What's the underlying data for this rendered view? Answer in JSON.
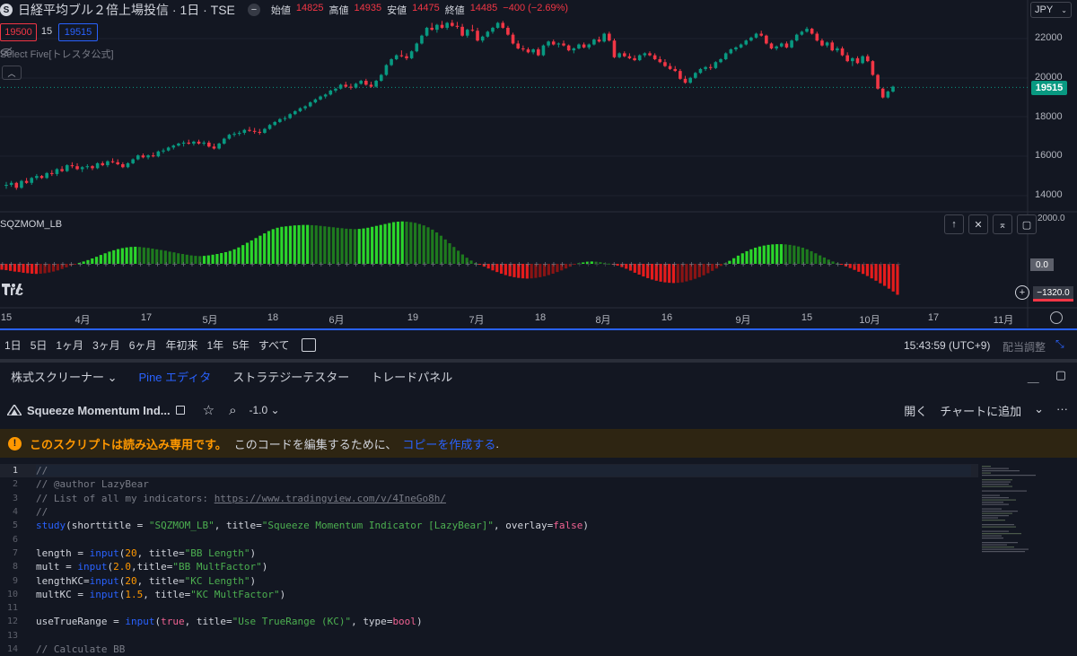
{
  "chart": {
    "symbol_logo": "S",
    "title": "日経平均ブル２倍上場投信 · 1日 · TSE",
    "ohlc": {
      "open_label": "始値",
      "open": "14825",
      "high_label": "高値",
      "high": "14935",
      "low_label": "安値",
      "low": "14475",
      "close_label": "終値",
      "close": "14485",
      "change": "−400 (−2.69%)"
    },
    "sell_price": "19500",
    "qty": "15",
    "buy_price": "19515",
    "indicator_name": "Select Five[トレスタ公式]",
    "currency": "JPY",
    "price_ticks": [
      "22000",
      "20000",
      "18000",
      "16000",
      "14000"
    ],
    "last_price": "19515",
    "squeeze_label": "SQZMOM_LB",
    "ind_max": "2000.0",
    "zero_tag": "0.0",
    "neg_tag": "−1320.0",
    "tv_logo": "Trc",
    "x_ticks": [
      "15",
      "4月",
      "17",
      "5月",
      "18",
      "6月",
      "19",
      "7月",
      "18",
      "8月",
      "16",
      "9月",
      "15",
      "10月",
      "17",
      "11月"
    ],
    "colors": {
      "up": "#089981",
      "down": "#f23645",
      "hist_bright_green": "#2bd62b",
      "hist_dark_green": "#1e7a1e",
      "hist_bright_red": "#e51c1c",
      "hist_dark_red": "#8a1414"
    },
    "candles": [
      [
        14500,
        14700,
        14350,
        14550
      ],
      [
        14550,
        14750,
        14450,
        14650
      ],
      [
        14650,
        14700,
        14300,
        14400
      ],
      [
        14400,
        14800,
        14350,
        14750
      ],
      [
        14750,
        14900,
        14600,
        14650
      ],
      [
        14650,
        14950,
        14550,
        14900
      ],
      [
        14900,
        15100,
        14800,
        15000
      ],
      [
        15000,
        15050,
        14850,
        14900
      ],
      [
        14900,
        15200,
        14850,
        15150
      ],
      [
        15150,
        15300,
        15000,
        15100
      ],
      [
        15100,
        15400,
        15000,
        15350
      ],
      [
        15350,
        15500,
        15200,
        15250
      ],
      [
        15250,
        15600,
        15200,
        15550
      ],
      [
        15550,
        15700,
        15400,
        15500
      ],
      [
        15500,
        15650,
        15300,
        15350
      ],
      [
        15350,
        15500,
        15200,
        15450
      ],
      [
        15450,
        15600,
        15350,
        15500
      ],
      [
        15500,
        15550,
        15300,
        15400
      ],
      [
        15400,
        15700,
        15350,
        15650
      ],
      [
        15650,
        15750,
        15500,
        15550
      ],
      [
        15550,
        15800,
        15450,
        15750
      ],
      [
        15750,
        15900,
        15650,
        15700
      ],
      [
        15700,
        15850,
        15550,
        15600
      ],
      [
        15600,
        15700,
        15400,
        15450
      ],
      [
        15450,
        15700,
        15400,
        15650
      ],
      [
        15650,
        15900,
        15600,
        15850
      ],
      [
        15850,
        16100,
        15800,
        16050
      ],
      [
        16050,
        16150,
        15900,
        15950
      ],
      [
        15950,
        16100,
        15850,
        16050
      ],
      [
        16050,
        16200,
        15950,
        16000
      ],
      [
        16000,
        16300,
        15950,
        16250
      ],
      [
        16250,
        16400,
        16150,
        16300
      ],
      [
        16300,
        16500,
        16250,
        16450
      ],
      [
        16450,
        16600,
        16350,
        16550
      ],
      [
        16550,
        16700,
        16500,
        16650
      ],
      [
        16650,
        16800,
        16500,
        16700
      ],
      [
        16700,
        16850,
        16600,
        16650
      ],
      [
        16650,
        16800,
        16550,
        16750
      ],
      [
        16750,
        16850,
        16600,
        16650
      ],
      [
        16650,
        16800,
        16550,
        16700
      ],
      [
        16700,
        16800,
        16450,
        16500
      ],
      [
        16500,
        16650,
        16350,
        16400
      ],
      [
        16400,
        16700,
        16350,
        16650
      ],
      [
        16650,
        16950,
        16600,
        16900
      ],
      [
        16900,
        17150,
        16850,
        17100
      ],
      [
        17100,
        17250,
        17000,
        17150
      ],
      [
        17150,
        17300,
        17050,
        17200
      ],
      [
        17200,
        17400,
        17100,
        17350
      ],
      [
        17350,
        17500,
        17250,
        17300
      ],
      [
        17300,
        17450,
        17150,
        17250
      ],
      [
        17250,
        17400,
        17100,
        17200
      ],
      [
        17200,
        17450,
        17150,
        17400
      ],
      [
        17400,
        17650,
        17350,
        17600
      ],
      [
        17600,
        17800,
        17550,
        17750
      ],
      [
        17750,
        17950,
        17700,
        17900
      ],
      [
        17900,
        18050,
        17800,
        17950
      ],
      [
        17950,
        18200,
        17900,
        18150
      ],
      [
        18150,
        18350,
        18100,
        18300
      ],
      [
        18300,
        18500,
        18250,
        18450
      ],
      [
        18450,
        18600,
        18350,
        18550
      ],
      [
        18550,
        18800,
        18500,
        18750
      ],
      [
        18750,
        18950,
        18700,
        18900
      ],
      [
        18900,
        19100,
        18850,
        19050
      ],
      [
        19050,
        19200,
        18950,
        19150
      ],
      [
        19150,
        19400,
        19100,
        19350
      ],
      [
        19350,
        19500,
        19250,
        19450
      ],
      [
        19450,
        19700,
        19400,
        19650
      ],
      [
        19650,
        19800,
        19500,
        19550
      ],
      [
        19550,
        19700,
        19400,
        19500
      ],
      [
        19500,
        19750,
        19450,
        19700
      ],
      [
        19700,
        19900,
        19650,
        19850
      ],
      [
        19850,
        19950,
        19600,
        19650
      ],
      [
        19650,
        19800,
        19500,
        19550
      ],
      [
        19550,
        19900,
        19500,
        19850
      ],
      [
        19850,
        20200,
        19800,
        20150
      ],
      [
        20150,
        20700,
        20100,
        20650
      ],
      [
        20650,
        21000,
        20600,
        20950
      ],
      [
        20950,
        21200,
        20900,
        21150
      ],
      [
        21150,
        21400,
        21050,
        21100
      ],
      [
        21100,
        21250,
        20900,
        21000
      ],
      [
        21000,
        21400,
        20950,
        21350
      ],
      [
        21350,
        21800,
        21300,
        21750
      ],
      [
        21750,
        22200,
        21700,
        22150
      ],
      [
        22150,
        22600,
        22100,
        22550
      ],
      [
        22550,
        22800,
        22400,
        22450
      ],
      [
        22450,
        22750,
        22300,
        22700
      ],
      [
        22700,
        22900,
        22500,
        22550
      ],
      [
        22550,
        22850,
        22450,
        22800
      ],
      [
        22800,
        22950,
        22600,
        22650
      ],
      [
        22650,
        22850,
        22500,
        22600
      ],
      [
        22600,
        22750,
        22100,
        22150
      ],
      [
        22150,
        22500,
        22050,
        22450
      ],
      [
        22450,
        22700,
        22350,
        22400
      ],
      [
        22400,
        22550,
        21850,
        21900
      ],
      [
        21900,
        22150,
        21800,
        22100
      ],
      [
        22100,
        22400,
        22050,
        22350
      ],
      [
        22350,
        22600,
        22250,
        22550
      ],
      [
        22550,
        22850,
        22500,
        22800
      ],
      [
        22800,
        22900,
        22500,
        22550
      ],
      [
        22550,
        22650,
        22150,
        22200
      ],
      [
        22200,
        22300,
        21700,
        21750
      ],
      [
        21750,
        21900,
        21450,
        21500
      ],
      [
        21500,
        21650,
        21350,
        21450
      ],
      [
        21450,
        21550,
        21250,
        21300
      ],
      [
        21300,
        21500,
        21200,
        21450
      ],
      [
        21450,
        21550,
        21100,
        21150
      ],
      [
        21150,
        21700,
        21100,
        21650
      ],
      [
        21650,
        21900,
        21550,
        21850
      ],
      [
        21850,
        21950,
        21650,
        21700
      ],
      [
        21700,
        21800,
        21550,
        21750
      ],
      [
        21750,
        21900,
        21600,
        21650
      ],
      [
        21650,
        21700,
        21350,
        21400
      ],
      [
        21400,
        21550,
        21250,
        21500
      ],
      [
        21500,
        21750,
        21450,
        21700
      ],
      [
        21700,
        21800,
        21500,
        21550
      ],
      [
        21550,
        21750,
        21450,
        21700
      ],
      [
        21700,
        22000,
        21650,
        21950
      ],
      [
        21950,
        22100,
        21800,
        21850
      ],
      [
        21850,
        22300,
        21800,
        22250
      ],
      [
        22250,
        22350,
        21850,
        21900
      ],
      [
        21900,
        22000,
        21000,
        21050
      ],
      [
        21050,
        21300,
        21000,
        21250
      ],
      [
        21250,
        21350,
        21050,
        21100
      ],
      [
        21100,
        21250,
        20950,
        21000
      ],
      [
        21000,
        21150,
        20850,
        20900
      ],
      [
        20900,
        21200,
        20850,
        21150
      ],
      [
        21150,
        21300,
        21050,
        21250
      ],
      [
        21250,
        21350,
        21100,
        21150
      ],
      [
        21150,
        21250,
        20900,
        20950
      ],
      [
        20950,
        21100,
        20750,
        20800
      ],
      [
        20800,
        20950,
        20550,
        20600
      ],
      [
        20600,
        20750,
        20400,
        20450
      ],
      [
        20450,
        20600,
        20300,
        20350
      ],
      [
        20350,
        20450,
        19900,
        19950
      ],
      [
        19950,
        20100,
        19700,
        19750
      ],
      [
        19750,
        20050,
        19700,
        20000
      ],
      [
        20000,
        20300,
        19950,
        20250
      ],
      [
        20250,
        20500,
        20200,
        20450
      ],
      [
        20450,
        20600,
        20350,
        20550
      ],
      [
        20550,
        20700,
        20400,
        20500
      ],
      [
        20500,
        20850,
        20450,
        20800
      ],
      [
        20800,
        21000,
        20750,
        20950
      ],
      [
        20950,
        21300,
        20900,
        21250
      ],
      [
        21250,
        21500,
        21200,
        21450
      ],
      [
        21450,
        21600,
        21350,
        21550
      ],
      [
        21550,
        21750,
        21500,
        21700
      ],
      [
        21700,
        21950,
        21650,
        21900
      ],
      [
        21900,
        22100,
        21850,
        22050
      ],
      [
        22050,
        22300,
        22000,
        22250
      ],
      [
        22250,
        22400,
        22100,
        22150
      ],
      [
        22150,
        22200,
        21700,
        21750
      ],
      [
        21750,
        21800,
        21450,
        21500
      ],
      [
        21500,
        21650,
        21400,
        21600
      ],
      [
        21600,
        21800,
        21550,
        21750
      ],
      [
        21750,
        21850,
        21500,
        21550
      ],
      [
        21550,
        21950,
        21500,
        21900
      ],
      [
        21900,
        22250,
        21850,
        22200
      ],
      [
        22200,
        22400,
        22150,
        22350
      ],
      [
        22350,
        22600,
        22300,
        22500
      ],
      [
        22500,
        22550,
        22200,
        22250
      ],
      [
        22250,
        22350,
        21850,
        21900
      ],
      [
        21900,
        22000,
        21600,
        21650
      ],
      [
        21650,
        21850,
        21550,
        21800
      ],
      [
        21800,
        21900,
        21350,
        21400
      ],
      [
        21400,
        21600,
        21300,
        21500
      ],
      [
        21500,
        21600,
        21100,
        21150
      ],
      [
        21150,
        21300,
        20800,
        20850
      ],
      [
        20850,
        21050,
        20600,
        21000
      ],
      [
        21000,
        21100,
        20700,
        20750
      ],
      [
        20750,
        21150,
        20700,
        21100
      ],
      [
        21100,
        21200,
        20800,
        20850
      ],
      [
        20850,
        20900,
        20100,
        20150
      ],
      [
        20150,
        20200,
        19400,
        19450
      ],
      [
        19450,
        19500,
        18950,
        19000
      ],
      [
        19000,
        19350,
        18950,
        19300
      ],
      [
        19300,
        19600,
        19250,
        19550
      ]
    ],
    "histogram": [
      -250,
      -270,
      -300,
      -330,
      -350,
      -380,
      -400,
      -420,
      -430,
      -420,
      -400,
      -370,
      -330,
      -280,
      -220,
      -150,
      -80,
      -20,
      40,
      100,
      160,
      230,
      300,
      380,
      450,
      520,
      580,
      630,
      670,
      700,
      720,
      730,
      720,
      700,
      680,
      650,
      620,
      590,
      560,
      520,
      490,
      450,
      420,
      390,
      360,
      340,
      330,
      340,
      360,
      390,
      420,
      460,
      500,
      550,
      620,
      700,
      800,
      900,
      1000,
      1100,
      1200,
      1300,
      1400,
      1480,
      1540,
      1580,
      1600,
      1620,
      1640,
      1650,
      1660,
      1660,
      1650,
      1640,
      1620,
      1600,
      1580,
      1560,
      1540,
      1520,
      1500,
      1490,
      1480,
      1490,
      1510,
      1540,
      1580,
      1620,
      1660,
      1700,
      1740,
      1780,
      1800,
      1810,
      1800,
      1780,
      1750,
      1700,
      1640,
      1560,
      1460,
      1340,
      1200,
      1040,
      880,
      720,
      560,
      400,
      260,
      140,
      40,
      -40,
      -120,
      -200,
      -280,
      -350,
      -420,
      -480,
      -530,
      -570,
      -600,
      -620,
      -630,
      -620,
      -600,
      -570,
      -530,
      -480,
      -420,
      -350,
      -280,
      -200,
      -120,
      -40,
      20,
      60,
      90,
      100,
      90,
      70,
      40,
      10,
      -30,
      -80,
      -140,
      -210,
      -290,
      -380,
      -460,
      -540,
      -610,
      -670,
      -720,
      -760,
      -790,
      -810,
      -820,
      -810,
      -790,
      -750,
      -700,
      -640,
      -570,
      -490,
      -400,
      -300,
      -200,
      -90,
      20,
      130,
      240,
      350,
      450,
      540,
      620,
      690,
      740,
      780,
      810,
      830,
      840,
      840,
      830,
      810,
      780,
      740,
      690,
      620,
      540,
      450,
      360,
      270,
      180,
      100,
      30,
      -40,
      -110,
      -180,
      -260,
      -340,
      -430,
      -520,
      -620,
      -720,
      -830,
      -940,
      -1060,
      -1180,
      -1320
    ]
  },
  "range_bar": {
    "ranges": [
      "1日",
      "5日",
      "1ヶ月",
      "3ヶ月",
      "6ヶ月",
      "年初来",
      "1年",
      "5年",
      "すべて"
    ],
    "clock": "15:43:59 (UTC+9)",
    "adjust": "配当調整"
  },
  "bottom_tabs": {
    "items": [
      "株式スクリーナー ⌄",
      "Pine エディタ",
      "ストラテジーテスター",
      "トレードパネル"
    ],
    "active_index": 1
  },
  "editor": {
    "script_name": "Squeeze Momentum Ind...",
    "version": "-1.0 ⌄",
    "open": "開く",
    "add_to_chart": "チャートに追加",
    "add_chevron": "⌄",
    "more": "···"
  },
  "warning": {
    "bold": "このスクリプトは読み込み専用です。",
    "normal": "このコードを編集するために、",
    "link": "コピーを作成する",
    "end": "."
  },
  "code_lines": [
    {
      "n": "1",
      "t": "//"
    },
    {
      "n": "2",
      "t": "// @author LazyBear"
    },
    {
      "n": "3",
      "t": "// List of all my indicators: https://www.tradingview.com/v/4IneGo8h/"
    },
    {
      "n": "4",
      "t": "//"
    },
    {
      "n": "5",
      "t": "study(shorttitle = \"SQZMOM_LB\", title=\"Squeeze Momentum Indicator [LazyBear]\", overlay=false)"
    },
    {
      "n": "6",
      "t": ""
    },
    {
      "n": "7",
      "t": "length = input(20, title=\"BB Length\")"
    },
    {
      "n": "8",
      "t": "mult = input(2.0,title=\"BB MultFactor\")"
    },
    {
      "n": "9",
      "t": "lengthKC=input(20, title=\"KC Length\")"
    },
    {
      "n": "10",
      "t": "multKC = input(1.5, title=\"KC MultFactor\")"
    },
    {
      "n": "11",
      "t": ""
    },
    {
      "n": "12",
      "t": "useTrueRange = input(true, title=\"Use TrueRange (KC)\", type=bool)"
    },
    {
      "n": "13",
      "t": ""
    },
    {
      "n": "14",
      "t": "// Calculate BB"
    }
  ]
}
